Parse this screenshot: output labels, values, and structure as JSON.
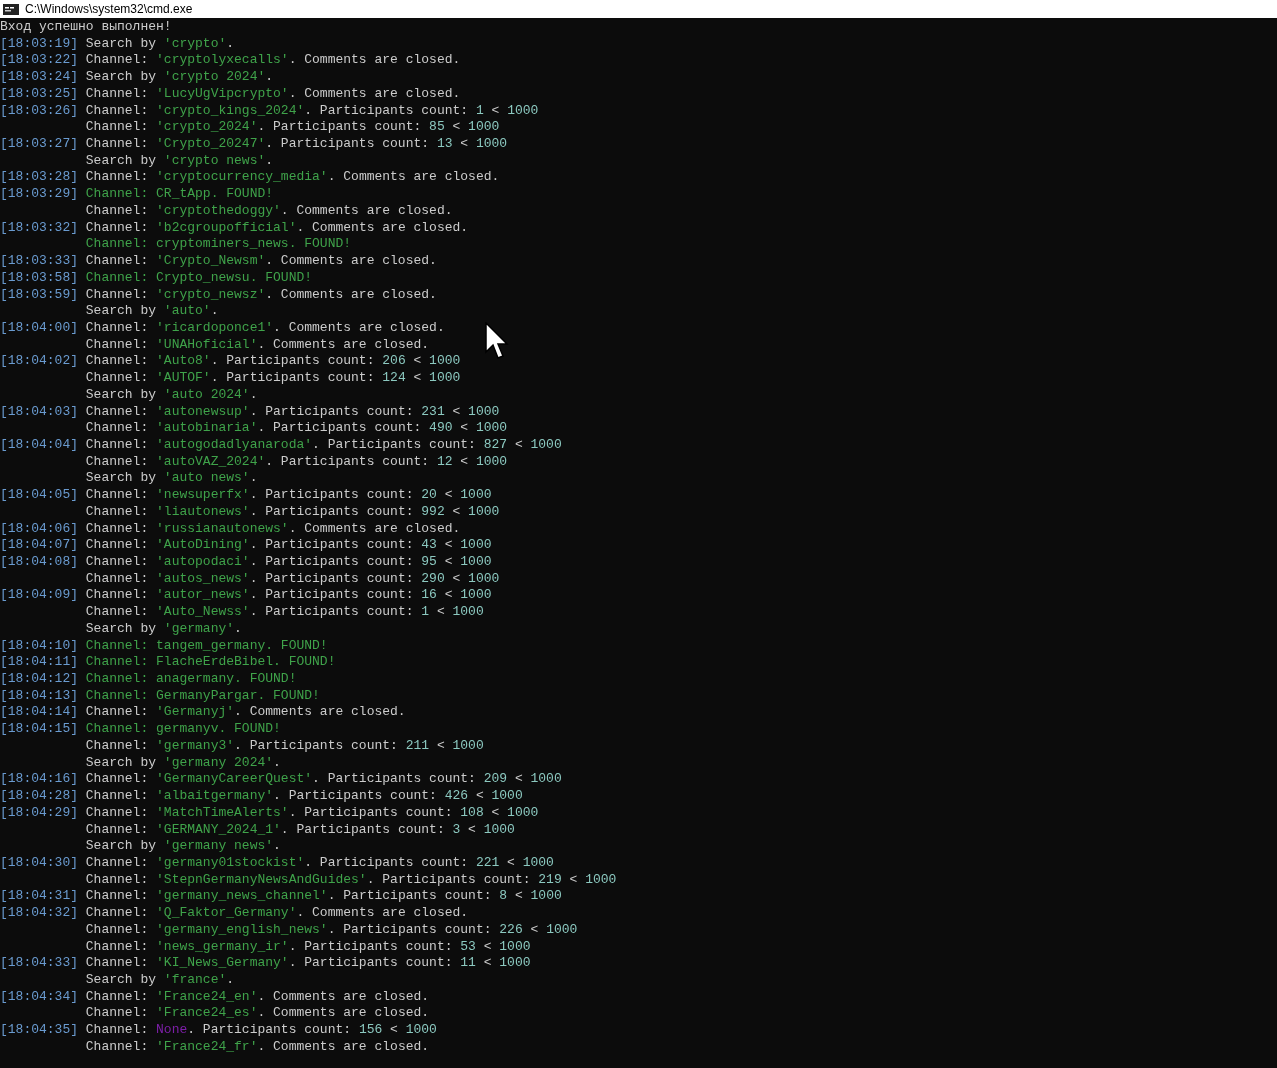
{
  "window": {
    "title": "C:\\Windows\\system32\\cmd.exe"
  },
  "console_lines": [
    {
      "segments": [
        {
          "kind": "plain",
          "text": "Вход успешно выполнен!"
        }
      ]
    },
    {
      "time": "[18:03:19]",
      "segments": [
        {
          "kind": "plain",
          "text": "Search by "
        },
        {
          "kind": "name",
          "text": "'crypto'"
        },
        {
          "kind": "plain",
          "text": "."
        }
      ]
    },
    {
      "time": "[18:03:22]",
      "segments": [
        {
          "kind": "plain",
          "text": "Channel: "
        },
        {
          "kind": "name",
          "text": "'cryptolyxecalls'"
        },
        {
          "kind": "plain",
          "text": ". Comments are closed."
        }
      ]
    },
    {
      "time": "[18:03:24]",
      "segments": [
        {
          "kind": "plain",
          "text": "Search by "
        },
        {
          "kind": "name",
          "text": "'crypto 2024'"
        },
        {
          "kind": "plain",
          "text": "."
        }
      ]
    },
    {
      "time": "[18:03:25]",
      "segments": [
        {
          "kind": "plain",
          "text": "Channel: "
        },
        {
          "kind": "name",
          "text": "'LucyUgVipcrypto'"
        },
        {
          "kind": "plain",
          "text": ". Comments are closed."
        }
      ]
    },
    {
      "time": "[18:03:26]",
      "segments": [
        {
          "kind": "plain",
          "text": "Channel: "
        },
        {
          "kind": "name",
          "text": "'crypto_kings_2024'"
        },
        {
          "kind": "plain",
          "text": ". Participants count: "
        },
        {
          "kind": "number",
          "text": "1"
        },
        {
          "kind": "plain",
          "text": " < "
        },
        {
          "kind": "number",
          "text": "1000"
        }
      ]
    },
    {
      "segments": [
        {
          "kind": "plain",
          "text": "Channel: "
        },
        {
          "kind": "name",
          "text": "'crypto_2024'"
        },
        {
          "kind": "plain",
          "text": ". Participants count: "
        },
        {
          "kind": "number",
          "text": "85"
        },
        {
          "kind": "plain",
          "text": " < "
        },
        {
          "kind": "number",
          "text": "1000"
        }
      ]
    },
    {
      "time": "[18:03:27]",
      "segments": [
        {
          "kind": "plain",
          "text": "Channel: "
        },
        {
          "kind": "name",
          "text": "'Crypto_20247'"
        },
        {
          "kind": "plain",
          "text": ". Participants count: "
        },
        {
          "kind": "number",
          "text": "13"
        },
        {
          "kind": "plain",
          "text": " < "
        },
        {
          "kind": "number",
          "text": "1000"
        }
      ]
    },
    {
      "segments": [
        {
          "kind": "plain",
          "text": "Search by "
        },
        {
          "kind": "name",
          "text": "'crypto news'"
        },
        {
          "kind": "plain",
          "text": "."
        }
      ]
    },
    {
      "time": "[18:03:28]",
      "segments": [
        {
          "kind": "plain",
          "text": "Channel: "
        },
        {
          "kind": "name",
          "text": "'cryptocurrency_media'"
        },
        {
          "kind": "plain",
          "text": ". Comments are closed."
        }
      ]
    },
    {
      "time": "[18:03:29]",
      "segments": [
        {
          "kind": "found",
          "text": "Channel: CR_tApp. FOUND!"
        }
      ]
    },
    {
      "segments": [
        {
          "kind": "plain",
          "text": "Channel: "
        },
        {
          "kind": "name",
          "text": "'cryptothedoggy'"
        },
        {
          "kind": "plain",
          "text": ". Comments are closed."
        }
      ]
    },
    {
      "time": "[18:03:32]",
      "segments": [
        {
          "kind": "plain",
          "text": "Channel: "
        },
        {
          "kind": "name",
          "text": "'b2cgroupofficial'"
        },
        {
          "kind": "plain",
          "text": ". Comments are closed."
        }
      ]
    },
    {
      "segments": [
        {
          "kind": "found",
          "text": "Channel: cryptominers_news. FOUND!"
        }
      ]
    },
    {
      "time": "[18:03:33]",
      "segments": [
        {
          "kind": "plain",
          "text": "Channel: "
        },
        {
          "kind": "name",
          "text": "'Crypto_Newsm'"
        },
        {
          "kind": "plain",
          "text": ". Comments are closed."
        }
      ]
    },
    {
      "time": "[18:03:58]",
      "segments": [
        {
          "kind": "found",
          "text": "Channel: Crypto_newsu. FOUND!"
        }
      ]
    },
    {
      "time": "[18:03:59]",
      "segments": [
        {
          "kind": "plain",
          "text": "Channel: "
        },
        {
          "kind": "name",
          "text": "'crypto_newsz'"
        },
        {
          "kind": "plain",
          "text": ". Comments are closed."
        }
      ]
    },
    {
      "segments": [
        {
          "kind": "plain",
          "text": "Search by "
        },
        {
          "kind": "name",
          "text": "'auto'"
        },
        {
          "kind": "plain",
          "text": "."
        }
      ]
    },
    {
      "time": "[18:04:00]",
      "segments": [
        {
          "kind": "plain",
          "text": "Channel: "
        },
        {
          "kind": "name",
          "text": "'ricardoponce1'"
        },
        {
          "kind": "plain",
          "text": ". Comments are closed."
        }
      ]
    },
    {
      "segments": [
        {
          "kind": "plain",
          "text": "Channel: "
        },
        {
          "kind": "name",
          "text": "'UNAHoficial'"
        },
        {
          "kind": "plain",
          "text": ". Comments are closed."
        }
      ]
    },
    {
      "time": "[18:04:02]",
      "segments": [
        {
          "kind": "plain",
          "text": "Channel: "
        },
        {
          "kind": "name",
          "text": "'Auto8'"
        },
        {
          "kind": "plain",
          "text": ". Participants count: "
        },
        {
          "kind": "number",
          "text": "206"
        },
        {
          "kind": "plain",
          "text": " < "
        },
        {
          "kind": "number",
          "text": "1000"
        }
      ]
    },
    {
      "segments": [
        {
          "kind": "plain",
          "text": "Channel: "
        },
        {
          "kind": "name",
          "text": "'AUTOF'"
        },
        {
          "kind": "plain",
          "text": ". Participants count: "
        },
        {
          "kind": "number",
          "text": "124"
        },
        {
          "kind": "plain",
          "text": " < "
        },
        {
          "kind": "number",
          "text": "1000"
        }
      ]
    },
    {
      "segments": [
        {
          "kind": "plain",
          "text": "Search by "
        },
        {
          "kind": "name",
          "text": "'auto 2024'"
        },
        {
          "kind": "plain",
          "text": "."
        }
      ]
    },
    {
      "time": "[18:04:03]",
      "segments": [
        {
          "kind": "plain",
          "text": "Channel: "
        },
        {
          "kind": "name",
          "text": "'autonewsup'"
        },
        {
          "kind": "plain",
          "text": ". Participants count: "
        },
        {
          "kind": "number",
          "text": "231"
        },
        {
          "kind": "plain",
          "text": " < "
        },
        {
          "kind": "number",
          "text": "1000"
        }
      ]
    },
    {
      "segments": [
        {
          "kind": "plain",
          "text": "Channel: "
        },
        {
          "kind": "name",
          "text": "'autobinaria'"
        },
        {
          "kind": "plain",
          "text": ". Participants count: "
        },
        {
          "kind": "number",
          "text": "490"
        },
        {
          "kind": "plain",
          "text": " < "
        },
        {
          "kind": "number",
          "text": "1000"
        }
      ]
    },
    {
      "time": "[18:04:04]",
      "segments": [
        {
          "kind": "plain",
          "text": "Channel: "
        },
        {
          "kind": "name",
          "text": "'autogodadlyanaroda'"
        },
        {
          "kind": "plain",
          "text": ". Participants count: "
        },
        {
          "kind": "number",
          "text": "827"
        },
        {
          "kind": "plain",
          "text": " < "
        },
        {
          "kind": "number",
          "text": "1000"
        }
      ]
    },
    {
      "segments": [
        {
          "kind": "plain",
          "text": "Channel: "
        },
        {
          "kind": "name",
          "text": "'autoVAZ_2024'"
        },
        {
          "kind": "plain",
          "text": ". Participants count: "
        },
        {
          "kind": "number",
          "text": "12"
        },
        {
          "kind": "plain",
          "text": " < "
        },
        {
          "kind": "number",
          "text": "1000"
        }
      ]
    },
    {
      "segments": [
        {
          "kind": "plain",
          "text": "Search by "
        },
        {
          "kind": "name",
          "text": "'auto news'"
        },
        {
          "kind": "plain",
          "text": "."
        }
      ]
    },
    {
      "time": "[18:04:05]",
      "segments": [
        {
          "kind": "plain",
          "text": "Channel: "
        },
        {
          "kind": "name",
          "text": "'newsuperfx'"
        },
        {
          "kind": "plain",
          "text": ". Participants count: "
        },
        {
          "kind": "number",
          "text": "20"
        },
        {
          "kind": "plain",
          "text": " < "
        },
        {
          "kind": "number",
          "text": "1000"
        }
      ]
    },
    {
      "segments": [
        {
          "kind": "plain",
          "text": "Channel: "
        },
        {
          "kind": "name",
          "text": "'liautonews'"
        },
        {
          "kind": "plain",
          "text": ". Participants count: "
        },
        {
          "kind": "number",
          "text": "992"
        },
        {
          "kind": "plain",
          "text": " < "
        },
        {
          "kind": "number",
          "text": "1000"
        }
      ]
    },
    {
      "time": "[18:04:06]",
      "segments": [
        {
          "kind": "plain",
          "text": "Channel: "
        },
        {
          "kind": "name",
          "text": "'russianautonews'"
        },
        {
          "kind": "plain",
          "text": ". Comments are closed."
        }
      ]
    },
    {
      "time": "[18:04:07]",
      "segments": [
        {
          "kind": "plain",
          "text": "Channel: "
        },
        {
          "kind": "name",
          "text": "'AutoDining'"
        },
        {
          "kind": "plain",
          "text": ". Participants count: "
        },
        {
          "kind": "number",
          "text": "43"
        },
        {
          "kind": "plain",
          "text": " < "
        },
        {
          "kind": "number",
          "text": "1000"
        }
      ]
    },
    {
      "time": "[18:04:08]",
      "segments": [
        {
          "kind": "plain",
          "text": "Channel: "
        },
        {
          "kind": "name",
          "text": "'autopodaci'"
        },
        {
          "kind": "plain",
          "text": ". Participants count: "
        },
        {
          "kind": "number",
          "text": "95"
        },
        {
          "kind": "plain",
          "text": " < "
        },
        {
          "kind": "number",
          "text": "1000"
        }
      ]
    },
    {
      "segments": [
        {
          "kind": "plain",
          "text": "Channel: "
        },
        {
          "kind": "name",
          "text": "'autos_news'"
        },
        {
          "kind": "plain",
          "text": ". Participants count: "
        },
        {
          "kind": "number",
          "text": "290"
        },
        {
          "kind": "plain",
          "text": " < "
        },
        {
          "kind": "number",
          "text": "1000"
        }
      ]
    },
    {
      "time": "[18:04:09]",
      "segments": [
        {
          "kind": "plain",
          "text": "Channel: "
        },
        {
          "kind": "name",
          "text": "'autor_news'"
        },
        {
          "kind": "plain",
          "text": ". Participants count: "
        },
        {
          "kind": "number",
          "text": "16"
        },
        {
          "kind": "plain",
          "text": " < "
        },
        {
          "kind": "number",
          "text": "1000"
        }
      ]
    },
    {
      "segments": [
        {
          "kind": "plain",
          "text": "Channel: "
        },
        {
          "kind": "name",
          "text": "'Auto_Newss'"
        },
        {
          "kind": "plain",
          "text": ". Participants count: "
        },
        {
          "kind": "number",
          "text": "1"
        },
        {
          "kind": "plain",
          "text": " < "
        },
        {
          "kind": "number",
          "text": "1000"
        }
      ]
    },
    {
      "segments": [
        {
          "kind": "plain",
          "text": "Search by "
        },
        {
          "kind": "name",
          "text": "'germany'"
        },
        {
          "kind": "plain",
          "text": "."
        }
      ]
    },
    {
      "time": "[18:04:10]",
      "segments": [
        {
          "kind": "found",
          "text": "Channel: tangem_germany. FOUND!"
        }
      ]
    },
    {
      "time": "[18:04:11]",
      "segments": [
        {
          "kind": "found",
          "text": "Channel: FlacheErdeBibel. FOUND!"
        }
      ]
    },
    {
      "time": "[18:04:12]",
      "segments": [
        {
          "kind": "found",
          "text": "Channel: anagermany. FOUND!"
        }
      ]
    },
    {
      "time": "[18:04:13]",
      "segments": [
        {
          "kind": "found",
          "text": "Channel: GermanyPargar. FOUND!"
        }
      ]
    },
    {
      "time": "[18:04:14]",
      "segments": [
        {
          "kind": "plain",
          "text": "Channel: "
        },
        {
          "kind": "name",
          "text": "'Germanyj'"
        },
        {
          "kind": "plain",
          "text": ". Comments are closed."
        }
      ]
    },
    {
      "time": "[18:04:15]",
      "segments": [
        {
          "kind": "found",
          "text": "Channel: germanyv. FOUND!"
        }
      ]
    },
    {
      "segments": [
        {
          "kind": "plain",
          "text": "Channel: "
        },
        {
          "kind": "name",
          "text": "'germany3'"
        },
        {
          "kind": "plain",
          "text": ". Participants count: "
        },
        {
          "kind": "number",
          "text": "211"
        },
        {
          "kind": "plain",
          "text": " < "
        },
        {
          "kind": "number",
          "text": "1000"
        }
      ]
    },
    {
      "segments": [
        {
          "kind": "plain",
          "text": "Search by "
        },
        {
          "kind": "name",
          "text": "'germany 2024'"
        },
        {
          "kind": "plain",
          "text": "."
        }
      ]
    },
    {
      "time": "[18:04:16]",
      "segments": [
        {
          "kind": "plain",
          "text": "Channel: "
        },
        {
          "kind": "name",
          "text": "'GermanyCareerQuest'"
        },
        {
          "kind": "plain",
          "text": ". Participants count: "
        },
        {
          "kind": "number",
          "text": "209"
        },
        {
          "kind": "plain",
          "text": " < "
        },
        {
          "kind": "number",
          "text": "1000"
        }
      ]
    },
    {
      "time": "[18:04:28]",
      "segments": [
        {
          "kind": "plain",
          "text": "Channel: "
        },
        {
          "kind": "name",
          "text": "'albaitgermany'"
        },
        {
          "kind": "plain",
          "text": ". Participants count: "
        },
        {
          "kind": "number",
          "text": "426"
        },
        {
          "kind": "plain",
          "text": " < "
        },
        {
          "kind": "number",
          "text": "1000"
        }
      ]
    },
    {
      "time": "[18:04:29]",
      "segments": [
        {
          "kind": "plain",
          "text": "Channel: "
        },
        {
          "kind": "name",
          "text": "'MatchTimeAlerts'"
        },
        {
          "kind": "plain",
          "text": ". Participants count: "
        },
        {
          "kind": "number",
          "text": "108"
        },
        {
          "kind": "plain",
          "text": " < "
        },
        {
          "kind": "number",
          "text": "1000"
        }
      ]
    },
    {
      "segments": [
        {
          "kind": "plain",
          "text": "Channel: "
        },
        {
          "kind": "name",
          "text": "'GERMANY_2024_1'"
        },
        {
          "kind": "plain",
          "text": ". Participants count: "
        },
        {
          "kind": "number",
          "text": "3"
        },
        {
          "kind": "plain",
          "text": " < "
        },
        {
          "kind": "number",
          "text": "1000"
        }
      ]
    },
    {
      "segments": [
        {
          "kind": "plain",
          "text": "Search by "
        },
        {
          "kind": "name",
          "text": "'germany news'"
        },
        {
          "kind": "plain",
          "text": "."
        }
      ]
    },
    {
      "time": "[18:04:30]",
      "segments": [
        {
          "kind": "plain",
          "text": "Channel: "
        },
        {
          "kind": "name",
          "text": "'germany01stockist'"
        },
        {
          "kind": "plain",
          "text": ". Participants count: "
        },
        {
          "kind": "number",
          "text": "221"
        },
        {
          "kind": "plain",
          "text": " < "
        },
        {
          "kind": "number",
          "text": "1000"
        }
      ]
    },
    {
      "segments": [
        {
          "kind": "plain",
          "text": "Channel: "
        },
        {
          "kind": "name",
          "text": "'StepnGermanyNewsAndGuides'"
        },
        {
          "kind": "plain",
          "text": ". Participants count: "
        },
        {
          "kind": "number",
          "text": "219"
        },
        {
          "kind": "plain",
          "text": " < "
        },
        {
          "kind": "number",
          "text": "1000"
        }
      ]
    },
    {
      "time": "[18:04:31]",
      "segments": [
        {
          "kind": "plain",
          "text": "Channel: "
        },
        {
          "kind": "name",
          "text": "'germany_news_channel'"
        },
        {
          "kind": "plain",
          "text": ". Participants count: "
        },
        {
          "kind": "number",
          "text": "8"
        },
        {
          "kind": "plain",
          "text": " < "
        },
        {
          "kind": "number",
          "text": "1000"
        }
      ]
    },
    {
      "time": "[18:04:32]",
      "segments": [
        {
          "kind": "plain",
          "text": "Channel: "
        },
        {
          "kind": "name",
          "text": "'Q_Faktor_Germany'"
        },
        {
          "kind": "plain",
          "text": ". Comments are closed."
        }
      ]
    },
    {
      "segments": [
        {
          "kind": "plain",
          "text": "Channel: "
        },
        {
          "kind": "name",
          "text": "'germany_english_news'"
        },
        {
          "kind": "plain",
          "text": ". Participants count: "
        },
        {
          "kind": "number",
          "text": "226"
        },
        {
          "kind": "plain",
          "text": " < "
        },
        {
          "kind": "number",
          "text": "1000"
        }
      ]
    },
    {
      "segments": [
        {
          "kind": "plain",
          "text": "Channel: "
        },
        {
          "kind": "name",
          "text": "'news_germany_ir'"
        },
        {
          "kind": "plain",
          "text": ". Participants count: "
        },
        {
          "kind": "number",
          "text": "53"
        },
        {
          "kind": "plain",
          "text": " < "
        },
        {
          "kind": "number",
          "text": "1000"
        }
      ]
    },
    {
      "time": "[18:04:33]",
      "segments": [
        {
          "kind": "plain",
          "text": "Channel: "
        },
        {
          "kind": "name",
          "text": "'KI_News_Germany'"
        },
        {
          "kind": "plain",
          "text": ". Participants count: "
        },
        {
          "kind": "number",
          "text": "11"
        },
        {
          "kind": "plain",
          "text": " < "
        },
        {
          "kind": "number",
          "text": "1000"
        }
      ]
    },
    {
      "segments": [
        {
          "kind": "plain",
          "text": "Search by "
        },
        {
          "kind": "name",
          "text": "'france'"
        },
        {
          "kind": "plain",
          "text": "."
        }
      ]
    },
    {
      "time": "[18:04:34]",
      "segments": [
        {
          "kind": "plain",
          "text": "Channel: "
        },
        {
          "kind": "name",
          "text": "'France24_en'"
        },
        {
          "kind": "plain",
          "text": ". Comments are closed."
        }
      ]
    },
    {
      "segments": [
        {
          "kind": "plain",
          "text": "Channel: "
        },
        {
          "kind": "name",
          "text": "'France24_es'"
        },
        {
          "kind": "plain",
          "text": ". Comments are closed."
        }
      ]
    },
    {
      "time": "[18:04:35]",
      "segments": [
        {
          "kind": "plain",
          "text": "Channel: "
        },
        {
          "kind": "none",
          "text": "None"
        },
        {
          "kind": "plain",
          "text": ". Participants count: "
        },
        {
          "kind": "number",
          "text": "156"
        },
        {
          "kind": "plain",
          "text": " < "
        },
        {
          "kind": "number",
          "text": "1000"
        }
      ]
    },
    {
      "segments": [
        {
          "kind": "plain",
          "text": "Channel: "
        },
        {
          "kind": "name",
          "text": "'France24_fr'"
        },
        {
          "kind": "plain",
          "text": ". Comments are closed."
        }
      ]
    }
  ]
}
